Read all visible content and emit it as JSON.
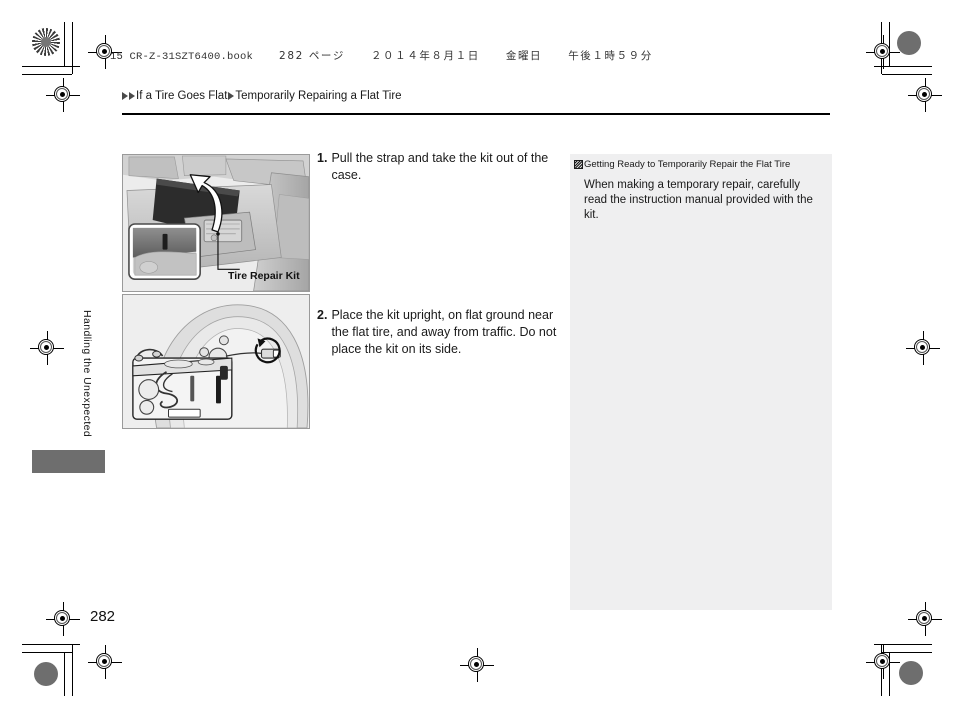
{
  "print_header": {
    "book_file": "15 CR-Z-31SZT6400.book",
    "page_ref": "282 ページ",
    "date": "２０１４年８月１日",
    "weekday": "金曜日",
    "time": "午後１時５９分"
  },
  "breadcrumb": {
    "section": "If a Tire Goes Flat",
    "subsection": "Temporarily Repairing a Flat Tire",
    "arrow_icon": "triangle-right-icon"
  },
  "side": {
    "chapter_label": "Handling the Unexpected",
    "page_number": "282"
  },
  "figures": [
    {
      "id": "fig1",
      "name": "trunk-cargo-floor-illustration",
      "caption": "Tire Repair Kit",
      "description": "Cargo area with lifted floor lid revealing the tire repair kit, with inset detail of the strap"
    },
    {
      "id": "fig2",
      "name": "tire-repair-kit-illustration",
      "caption": "",
      "description": "Tire repair kit placed upright on the ground beside the flat tire, hose connected to the valve"
    }
  ],
  "steps": [
    {
      "number": "1.",
      "text": "Pull the strap and take the kit out of the case."
    },
    {
      "number": "2.",
      "text": "Place the kit upright, on flat ground near the flat tire, and away from traffic. Do not place the kit on its side."
    }
  ],
  "note_panel": {
    "icon": "reference-marker-icon",
    "title": "Getting Ready to Temporarily Repair the Flat Tire",
    "body": "When making a temporary repair, carefully read the instruction manual provided with the kit.",
    "background_color": "#efeff0"
  },
  "print_marks": {
    "registration_icon": "registration-target-icon",
    "color_patch_icon": "color-density-patch-icon",
    "star_target_icon": "star-target-icon"
  }
}
